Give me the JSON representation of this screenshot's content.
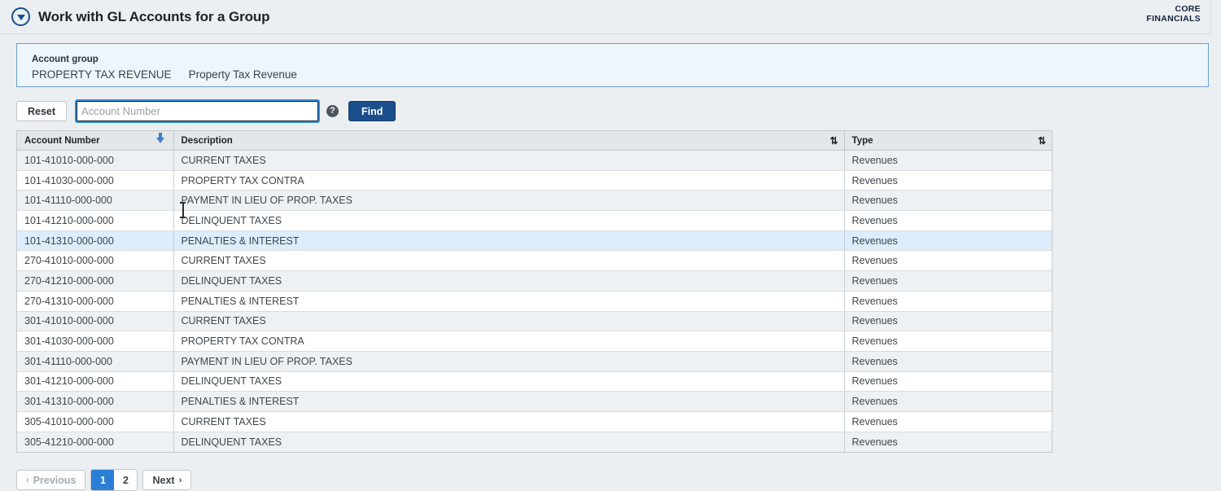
{
  "header": {
    "collapse_icon": "circle-chevron-down-icon",
    "title": "Work with GL Accounts for a Group",
    "brand_line1": "CORE",
    "brand_line2": "FINANCIALS"
  },
  "account_group": {
    "label": "Account group",
    "code": "PROPERTY TAX REVENUE",
    "name": "Property Tax Revenue"
  },
  "search": {
    "reset_label": "Reset",
    "input_value": "",
    "input_placeholder": "Account Number",
    "help_icon": "help-question-icon",
    "find_label": "Find"
  },
  "table": {
    "columns": [
      {
        "key": "account_number",
        "label": "Account Number",
        "sort": "desc"
      },
      {
        "key": "description",
        "label": "Description",
        "sort": "none"
      },
      {
        "key": "type",
        "label": "Type",
        "sort": "none"
      }
    ],
    "rows": [
      {
        "account_number": "101-41010-000-000",
        "description": "CURRENT TAXES",
        "type": "Revenues"
      },
      {
        "account_number": "101-41030-000-000",
        "description": "PROPERTY TAX CONTRA",
        "type": "Revenues"
      },
      {
        "account_number": "101-41110-000-000",
        "description": "PAYMENT IN LIEU OF PROP. TAXES",
        "type": "Revenues"
      },
      {
        "account_number": "101-41210-000-000",
        "description": "DELINQUENT TAXES",
        "type": "Revenues"
      },
      {
        "account_number": "101-41310-000-000",
        "description": "PENALTIES & INTEREST",
        "type": "Revenues"
      },
      {
        "account_number": "270-41010-000-000",
        "description": "CURRENT TAXES",
        "type": "Revenues"
      },
      {
        "account_number": "270-41210-000-000",
        "description": "DELINQUENT TAXES",
        "type": "Revenues"
      },
      {
        "account_number": "270-41310-000-000",
        "description": "PENALTIES & INTEREST",
        "type": "Revenues"
      },
      {
        "account_number": "301-41010-000-000",
        "description": "CURRENT TAXES",
        "type": "Revenues"
      },
      {
        "account_number": "301-41030-000-000",
        "description": "PROPERTY TAX CONTRA",
        "type": "Revenues"
      },
      {
        "account_number": "301-41110-000-000",
        "description": "PAYMENT IN LIEU OF PROP. TAXES",
        "type": "Revenues"
      },
      {
        "account_number": "301-41210-000-000",
        "description": "DELINQUENT TAXES",
        "type": "Revenues"
      },
      {
        "account_number": "301-41310-000-000",
        "description": "PENALTIES & INTEREST",
        "type": "Revenues"
      },
      {
        "account_number": "305-41010-000-000",
        "description": "CURRENT TAXES",
        "type": "Revenues"
      },
      {
        "account_number": "305-41210-000-000",
        "description": "DELINQUENT TAXES",
        "type": "Revenues"
      }
    ],
    "highlighted_row_index": 4
  },
  "pagination": {
    "previous_label": "Previous",
    "previous_chevron": "‹",
    "next_label": "Next",
    "next_chevron": "›",
    "pages": [
      "1",
      "2"
    ],
    "active_page": "1",
    "previous_disabled": true
  },
  "colors": {
    "accent_blue": "#2a7fd4",
    "brand_navy": "#1b4e8c",
    "panel_blue": "#eef5fc",
    "row_highlight": "#dcedfb"
  }
}
